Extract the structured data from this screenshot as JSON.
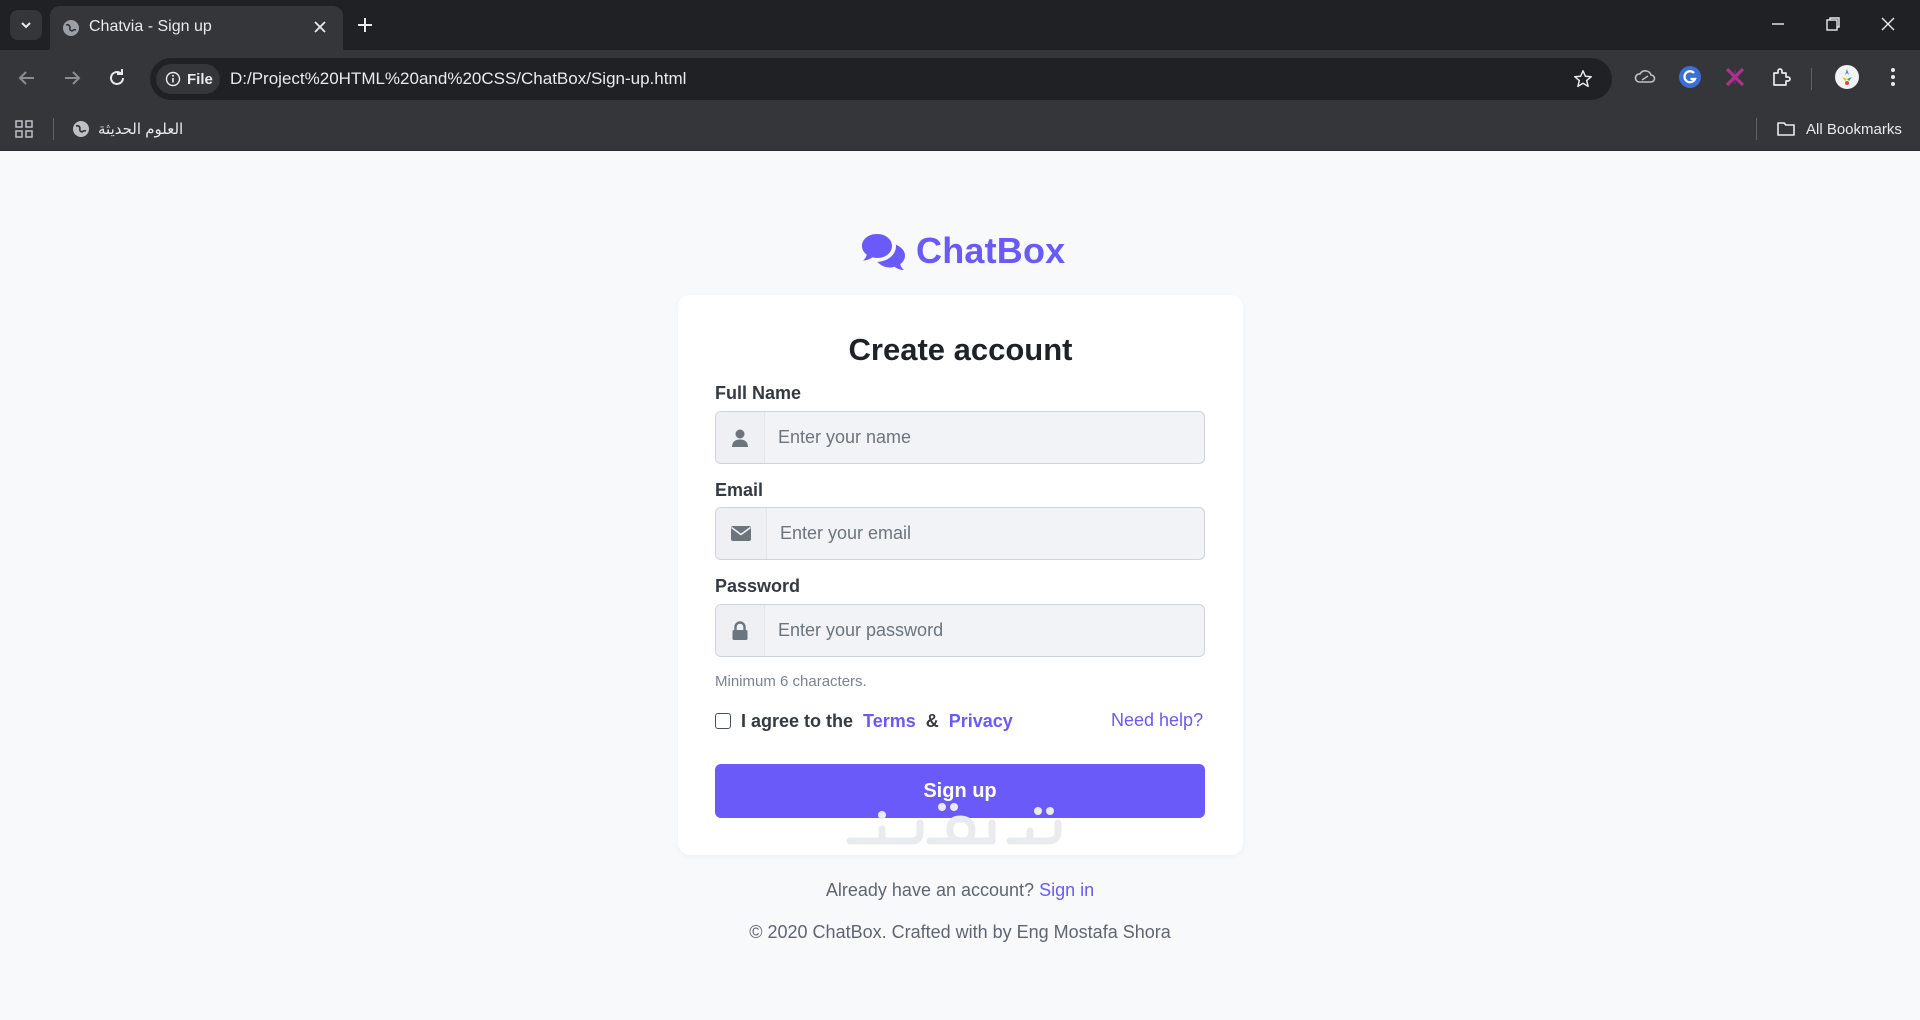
{
  "browser": {
    "tab_title": "Chatvia - Sign up",
    "chip_label": "File",
    "url": "D:/Project%20HTML%20and%20CSS/ChatBox/Sign-up.html",
    "bookmark_item": "العلوم الحديثة",
    "all_bookmarks": "All Bookmarks"
  },
  "brand": {
    "name": "ChatBox",
    "color": "#6a5af9"
  },
  "form": {
    "title": "Create account",
    "full_name": {
      "label": "Full Name",
      "placeholder": "Enter your name",
      "icon": "user-icon"
    },
    "email": {
      "label": "Email",
      "placeholder": "Enter your email",
      "icon": "envelope-icon"
    },
    "password": {
      "label": "Password",
      "placeholder": "Enter your password",
      "icon": "lock-icon",
      "hint": "Minimum 6 characters."
    },
    "agree": {
      "checked": false,
      "prefix": "I agree to the",
      "terms": "Terms",
      "amp": "&",
      "privacy": "Privacy"
    },
    "need_help": "Need help?",
    "submit": "Sign up"
  },
  "footer": {
    "have_account": "Already have an account?",
    "sign_in": "Sign in",
    "copyright": "© 2020 ChatBox. Crafted with by Eng Mostafa Shora"
  },
  "watermark": "خمسات"
}
